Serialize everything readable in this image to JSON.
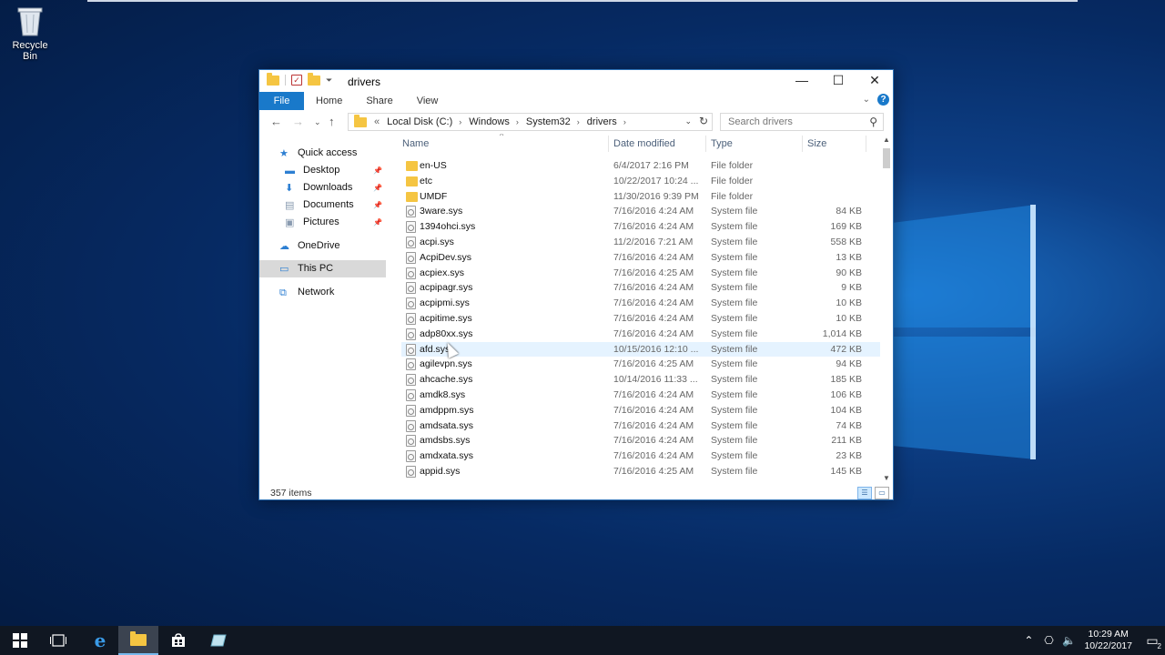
{
  "desktop": {
    "recycle_bin_label": "Recycle Bin"
  },
  "window": {
    "title": "drivers",
    "ribbon_tabs": [
      "File",
      "Home",
      "Share",
      "View"
    ],
    "address": {
      "prefix": "«",
      "crumbs": [
        "Local Disk (C:)",
        "Windows",
        "System32",
        "drivers"
      ]
    },
    "search_placeholder": "Search drivers",
    "columns": {
      "name": "Name",
      "date": "Date modified",
      "type": "Type",
      "size": "Size"
    },
    "sidebar": [
      {
        "label": "Quick access",
        "icon": "star-icon",
        "indent": 0
      },
      {
        "label": "Desktop",
        "icon": "desktop-icon",
        "indent": 1,
        "pinned": true
      },
      {
        "label": "Downloads",
        "icon": "download-icon",
        "indent": 1,
        "pinned": true
      },
      {
        "label": "Documents",
        "icon": "documents-icon",
        "indent": 1,
        "pinned": true
      },
      {
        "label": "Pictures",
        "icon": "pictures-icon",
        "indent": 1,
        "pinned": true
      },
      {
        "label": "OneDrive",
        "icon": "cloud-icon",
        "indent": 0
      },
      {
        "label": "This PC",
        "icon": "computer-icon",
        "indent": 0,
        "selected": true
      },
      {
        "label": "Network",
        "icon": "network-icon",
        "indent": 0
      }
    ],
    "files": [
      {
        "name": "en-US",
        "date": "6/4/2017 2:16 PM",
        "type": "File folder",
        "size": "",
        "kind": "folder"
      },
      {
        "name": "etc",
        "date": "10/22/2017 10:24 ...",
        "type": "File folder",
        "size": "",
        "kind": "folder"
      },
      {
        "name": "UMDF",
        "date": "11/30/2016 9:39 PM",
        "type": "File folder",
        "size": "",
        "kind": "folder"
      },
      {
        "name": "3ware.sys",
        "date": "7/16/2016 4:24 AM",
        "type": "System file",
        "size": "84 KB",
        "kind": "sys"
      },
      {
        "name": "1394ohci.sys",
        "date": "7/16/2016 4:24 AM",
        "type": "System file",
        "size": "169 KB",
        "kind": "sys"
      },
      {
        "name": "acpi.sys",
        "date": "11/2/2016 7:21 AM",
        "type": "System file",
        "size": "558 KB",
        "kind": "sys"
      },
      {
        "name": "AcpiDev.sys",
        "date": "7/16/2016 4:24 AM",
        "type": "System file",
        "size": "13 KB",
        "kind": "sys"
      },
      {
        "name": "acpiex.sys",
        "date": "7/16/2016 4:25 AM",
        "type": "System file",
        "size": "90 KB",
        "kind": "sys"
      },
      {
        "name": "acpipagr.sys",
        "date": "7/16/2016 4:24 AM",
        "type": "System file",
        "size": "9 KB",
        "kind": "sys"
      },
      {
        "name": "acpipmi.sys",
        "date": "7/16/2016 4:24 AM",
        "type": "System file",
        "size": "10 KB",
        "kind": "sys"
      },
      {
        "name": "acpitime.sys",
        "date": "7/16/2016 4:24 AM",
        "type": "System file",
        "size": "10 KB",
        "kind": "sys"
      },
      {
        "name": "adp80xx.sys",
        "date": "7/16/2016 4:24 AM",
        "type": "System file",
        "size": "1,014 KB",
        "kind": "sys"
      },
      {
        "name": "afd.sys",
        "date": "10/15/2016 12:10 ...",
        "type": "System file",
        "size": "472 KB",
        "kind": "sys",
        "hover": true
      },
      {
        "name": "agilevpn.sys",
        "date": "7/16/2016 4:25 AM",
        "type": "System file",
        "size": "94 KB",
        "kind": "sys"
      },
      {
        "name": "ahcache.sys",
        "date": "10/14/2016 11:33 ...",
        "type": "System file",
        "size": "185 KB",
        "kind": "sys"
      },
      {
        "name": "amdk8.sys",
        "date": "7/16/2016 4:24 AM",
        "type": "System file",
        "size": "106 KB",
        "kind": "sys"
      },
      {
        "name": "amdppm.sys",
        "date": "7/16/2016 4:24 AM",
        "type": "System file",
        "size": "104 KB",
        "kind": "sys"
      },
      {
        "name": "amdsata.sys",
        "date": "7/16/2016 4:24 AM",
        "type": "System file",
        "size": "74 KB",
        "kind": "sys"
      },
      {
        "name": "amdsbs.sys",
        "date": "7/16/2016 4:24 AM",
        "type": "System file",
        "size": "211 KB",
        "kind": "sys"
      },
      {
        "name": "amdxata.sys",
        "date": "7/16/2016 4:24 AM",
        "type": "System file",
        "size": "23 KB",
        "kind": "sys"
      },
      {
        "name": "appid.sys",
        "date": "7/16/2016 4:25 AM",
        "type": "System file",
        "size": "145 KB",
        "kind": "sys"
      }
    ],
    "status": "357 items"
  },
  "taskbar": {
    "clock_time": "10:29 AM",
    "clock_date": "10/22/2017",
    "notification_count": "2"
  }
}
